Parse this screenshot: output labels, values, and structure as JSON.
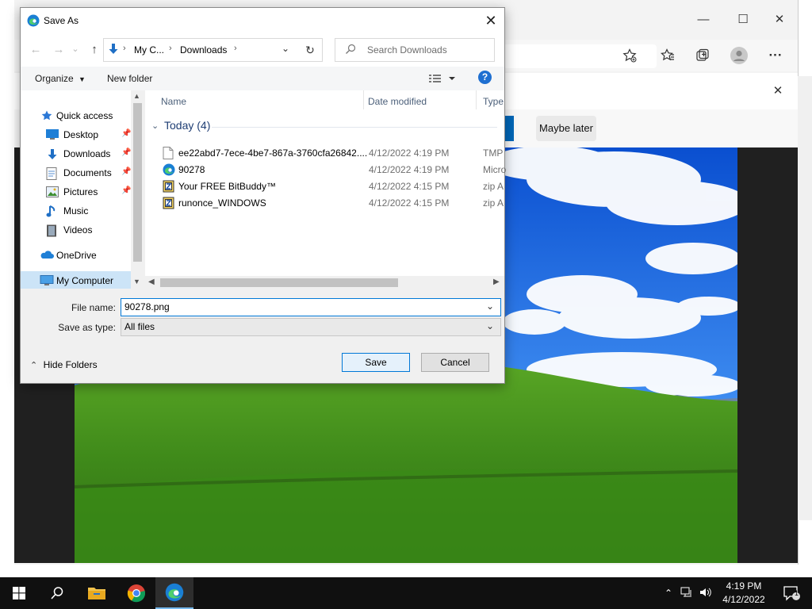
{
  "dialog": {
    "title": "Save As",
    "close_glyph": "✕",
    "nav": {
      "back_glyph": "←",
      "forward_glyph": "→",
      "recent_glyph": "⌄",
      "up_glyph": "↑",
      "breadcrumb": [
        "My C...",
        "Downloads"
      ],
      "sep_glyph": "›",
      "dropdown_glyph": "⌄",
      "refresh_glyph": "↻",
      "search_placeholder": "Search Downloads"
    },
    "toolbar": {
      "organize": "Organize",
      "new_folder": "New folder",
      "help_glyph": "?"
    },
    "sidebar": [
      {
        "label": "Quick access",
        "icon": "star-icon"
      },
      {
        "label": "Desktop",
        "icon": "desktop-icon",
        "pinned": true
      },
      {
        "label": "Downloads",
        "icon": "download-icon",
        "pinned": true
      },
      {
        "label": "Documents",
        "icon": "documents-icon",
        "pinned": true
      },
      {
        "label": "Pictures",
        "icon": "pictures-icon",
        "pinned": true
      },
      {
        "label": "Music",
        "icon": "music-icon"
      },
      {
        "label": "Videos",
        "icon": "videos-icon"
      },
      {
        "label": "OneDrive",
        "icon": "cloud-icon"
      },
      {
        "label": "My Computer",
        "icon": "computer-icon",
        "selected": true
      }
    ],
    "columns": {
      "name": "Name",
      "date": "Date modified",
      "type": "Type"
    },
    "group_header": "Today (4)",
    "files": [
      {
        "name": "ee22abd7-7ece-4be7-867a-3760cfa26842....",
        "date": "4/12/2022 4:19 PM",
        "type": "TMP",
        "icon": "file-icon"
      },
      {
        "name": "90278",
        "date": "4/12/2022 4:19 PM",
        "type": "Micro",
        "icon": "edge-icon"
      },
      {
        "name": "Your FREE BitBuddy™",
        "date": "4/12/2022 4:15 PM",
        "type": "zip A",
        "icon": "zip-icon"
      },
      {
        "name": "runonce_WINDOWS",
        "date": "4/12/2022 4:15 PM",
        "type": "zip A",
        "icon": "zip-icon"
      }
    ],
    "file_name_label": "File name:",
    "file_name_value": "90278.png",
    "save_type_label": "Save as type:",
    "save_type_value": "All files",
    "hide_folders": "Hide Folders",
    "save_button": "Save",
    "cancel_button": "Cancel"
  },
  "browser": {
    "maybe_later": "Maybe later",
    "close_glyph": "✕",
    "minimize_glyph": "—",
    "maximize_glyph": "☐",
    "more_glyph": "···"
  },
  "taskbar": {
    "time": "4:19 PM",
    "date": "4/12/2022",
    "notification_count": "1"
  },
  "colors": {
    "accent": "#0078d7",
    "taskbar": "#101010",
    "sky": "#1e6fd9",
    "grass": "#4f9a1e"
  }
}
